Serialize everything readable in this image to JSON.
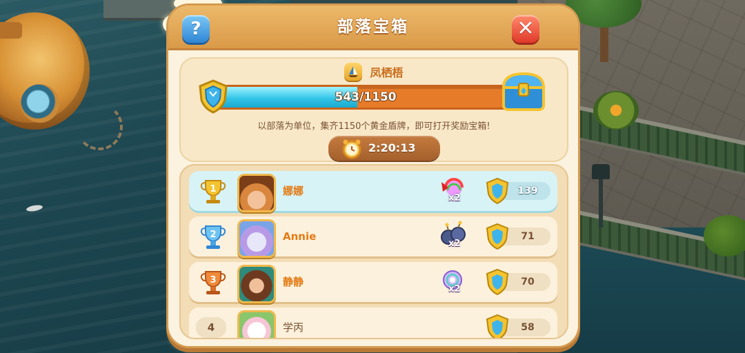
{
  "dialog": {
    "title": "部落宝箱",
    "help_label": "?",
    "close_label": "✕"
  },
  "tribe": {
    "name": "凤栖梧",
    "icon": "sailboat-badge-icon"
  },
  "progress": {
    "current": 543,
    "goal": 1150,
    "label": "543/1150",
    "fill_fraction": 0.472
  },
  "description": "以部落为单位，集齐1150个黄金盾牌，即可打开奖励宝箱!",
  "timer": {
    "icon": "alarm-clock-icon",
    "value": "2:20:13"
  },
  "colors": {
    "progress_fill": "#33c6e8",
    "progress_track": "#e67b2a",
    "name_highlight": "#e37b16",
    "panel_bg": "#fbf2df"
  },
  "leaderboard": [
    {
      "rank": "1",
      "name": "娜娜",
      "reward_icon": "rainbow-candy-icon",
      "reward_mult": "x2",
      "score": "139",
      "highlight": true
    },
    {
      "rank": "2",
      "name": "Annie",
      "reward_icon": "bomb-pair-icon",
      "reward_mult": "x2",
      "score": "71",
      "highlight": false
    },
    {
      "rank": "3",
      "name": "静静",
      "reward_icon": "rainbow-orb-icon",
      "reward_mult": "x2",
      "score": "70",
      "highlight": false
    },
    {
      "rank": "4",
      "name": "学丙",
      "reward_icon": "",
      "reward_mult": "",
      "score": "58",
      "highlight": false
    }
  ]
}
